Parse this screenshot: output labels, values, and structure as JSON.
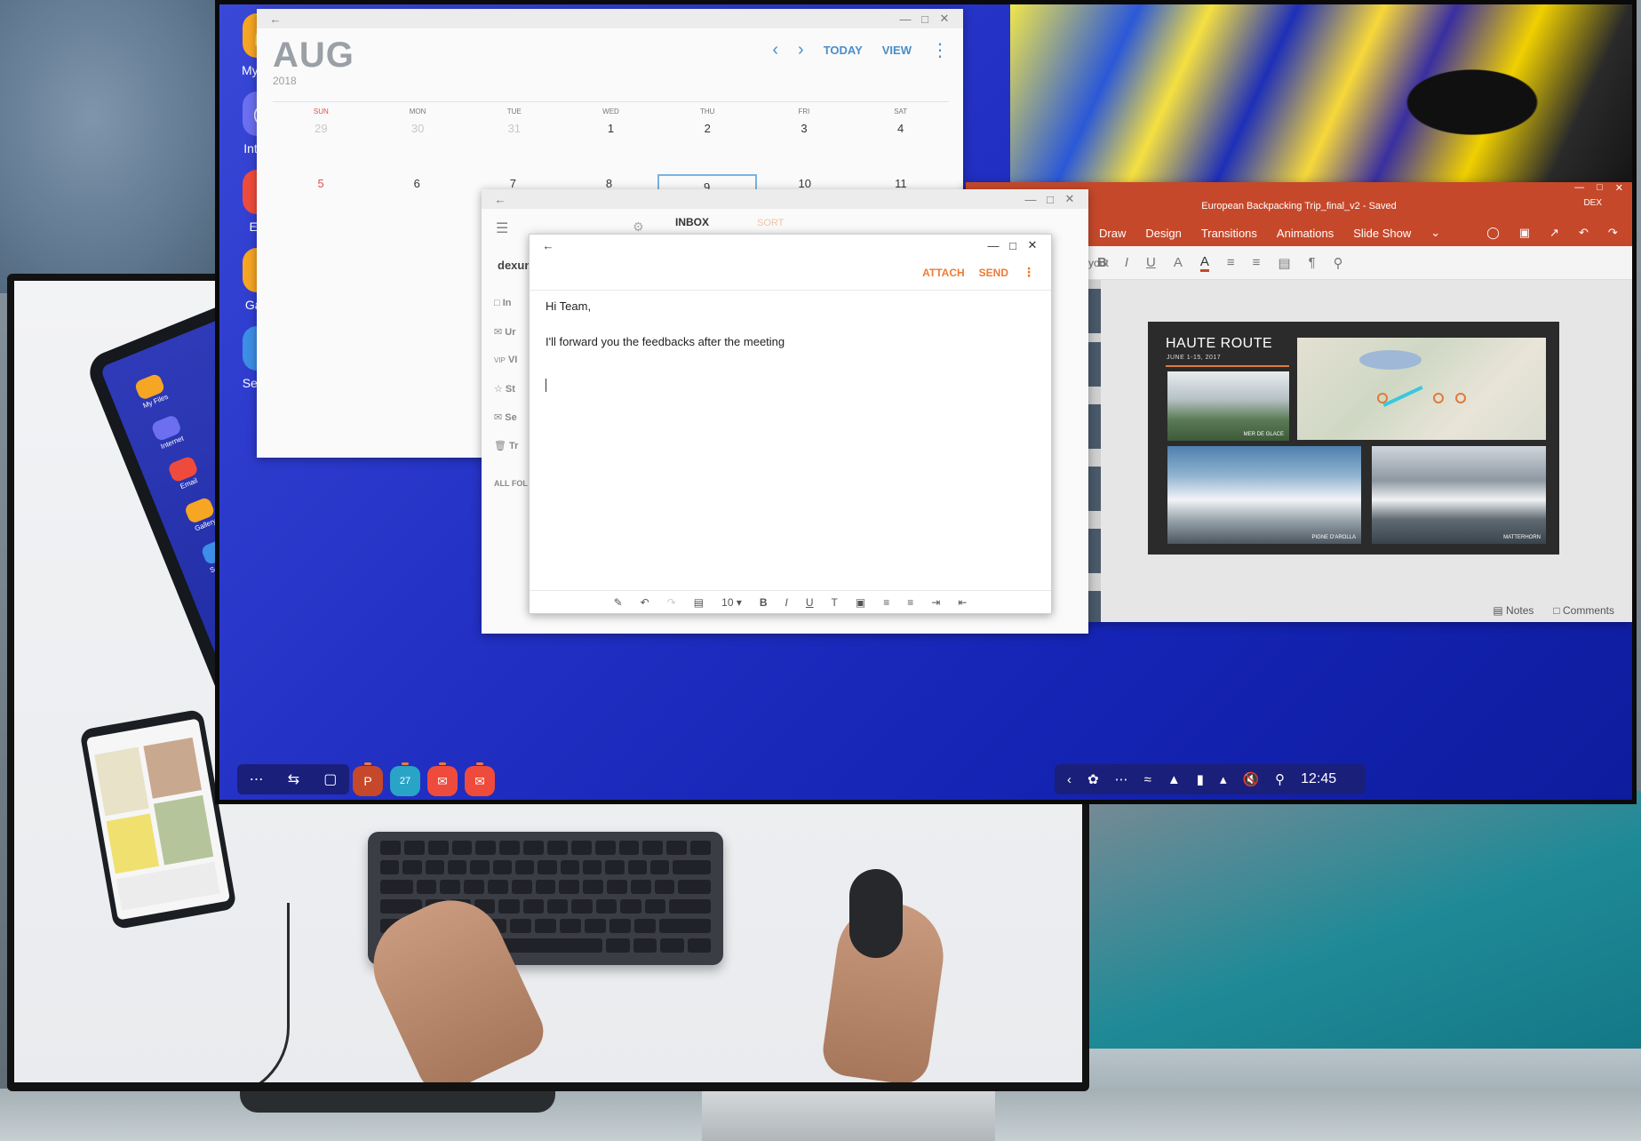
{
  "desktop_icons": [
    {
      "label": "My Files",
      "icon": "folder-icon",
      "color": "#f6a623"
    },
    {
      "label": "Internet",
      "icon": "globe-icon",
      "color": "#6b6ff0"
    },
    {
      "label": "Email",
      "icon": "mail-icon",
      "color": "#ef4b3c"
    },
    {
      "label": "Gallery",
      "icon": "flower-icon",
      "color": "#f6a623"
    },
    {
      "label": "Settings",
      "icon": "gear-icon",
      "color": "#3d8ee6"
    }
  ],
  "calendar": {
    "month": "AUG",
    "year": "2018",
    "today_label": "TODAY",
    "view_label": "VIEW",
    "days_of_week": [
      "SUN",
      "MON",
      "TUE",
      "WED",
      "THU",
      "FRI",
      "SAT"
    ],
    "week1": [
      "29",
      "30",
      "31",
      "1",
      "2",
      "3",
      "4"
    ],
    "week2": [
      "5",
      "6",
      "7",
      "8",
      "9",
      "10",
      "11"
    ]
  },
  "mail_list": {
    "account": "dexun",
    "inbox_label": "INBOX",
    "sort_label": "SORT",
    "folders": [
      "In",
      "Ur",
      "VI",
      "St",
      "Se",
      "Tr"
    ],
    "vip_label": "VIP",
    "all_folders": "ALL FOL"
  },
  "compose": {
    "attach_label": "ATTACH",
    "send_label": "SEND",
    "greeting": "Hi Team,",
    "message": "I'll forward you the feedbacks after the meeting",
    "font_size": "10"
  },
  "powerpoint": {
    "doc_title": "European Backpacking Trip_final_v2 - Saved",
    "account_badge": "DEX",
    "menu": [
      "Draw",
      "Design",
      "Transitions",
      "Animations",
      "Slide Show"
    ],
    "layout_label": "yout",
    "slide": {
      "title": "HAUTE ROUTE",
      "subtitle": "JUNE 1-15, 2017",
      "caption1": "MER DE GLACE",
      "caption2": "PIGNE D'AROLLA",
      "caption3": "MATTERHORN"
    },
    "notes_label": "Notes",
    "comments_label": "Comments"
  },
  "taskbar": {
    "clock": "12:45",
    "calendar_day": "27"
  },
  "tablet_apps": [
    "My Files",
    "Internet",
    "Email",
    "Gallery",
    "Settings"
  ],
  "colors": {
    "dex_blue": "#2230c4",
    "accent_orange": "#f07a35",
    "ppt_red": "#c6482a",
    "calendar_blue": "#4a8ec8"
  }
}
